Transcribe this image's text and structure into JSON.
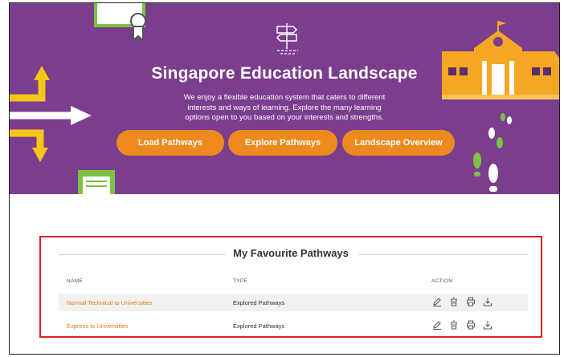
{
  "hero": {
    "title": "Singapore Education Landscape",
    "description": "We enjoy a flexible education system that caters to different interests and ways of learning. Explore the many learning options open to you based on your interests and strengths.",
    "buttons": {
      "load": "Load Pathways",
      "explore": "Explore Pathways",
      "overview": "Landscape Overview"
    }
  },
  "favourites": {
    "title": "My Favourite Pathways",
    "columns": {
      "name": "NAME",
      "type": "TYPE",
      "action": "ACTION"
    },
    "rows": [
      {
        "name": "Normal Technical to Universities",
        "type": "Explored Pathways"
      },
      {
        "name": "Express to Universities",
        "type": "Explored Pathways"
      }
    ],
    "actions": [
      "edit-icon",
      "delete-icon",
      "print-icon",
      "download-icon"
    ]
  },
  "colors": {
    "hero_bg": "#7b3d8e",
    "accent_orange": "#ec8a20",
    "highlight_border": "#e02020",
    "link": "#e07b12"
  }
}
